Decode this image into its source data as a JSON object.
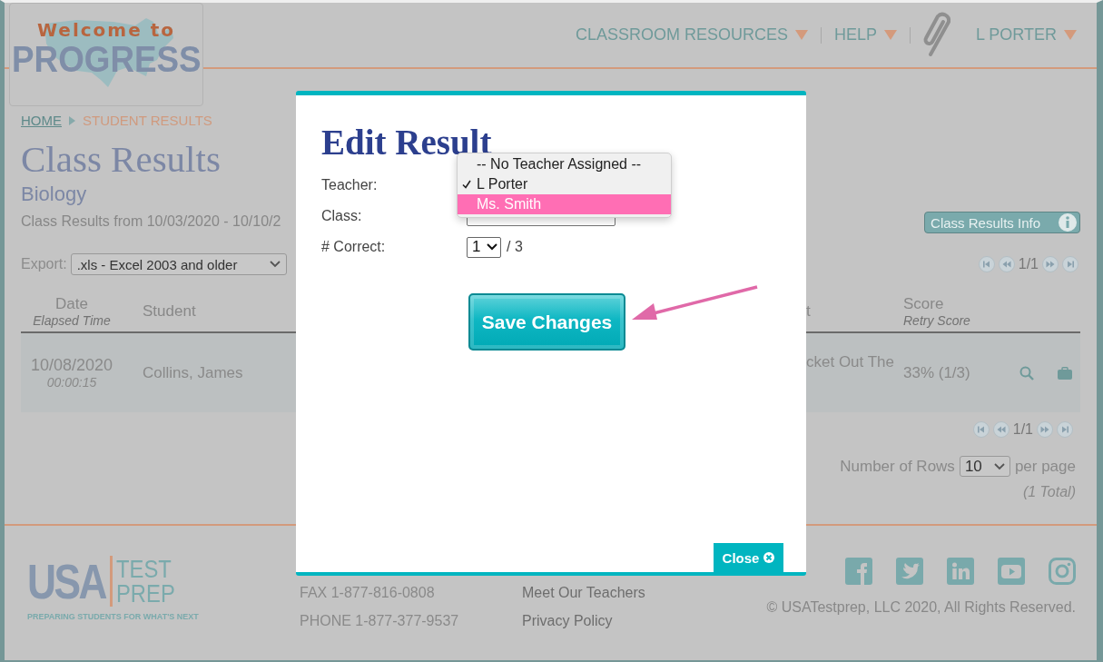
{
  "header": {
    "logo": {
      "line1": "Welcome to",
      "line2": "PROGRESS"
    },
    "nav": [
      {
        "label": "CLASSROOM RESOURCES",
        "kind": "menu"
      },
      {
        "label": "HELP",
        "kind": "menu"
      },
      {
        "label": "L PORTER",
        "kind": "user"
      }
    ]
  },
  "breadcrumb": [
    {
      "label": "HOME",
      "kind": "link"
    },
    {
      "label": "STUDENT RESULTS",
      "kind": "current"
    }
  ],
  "page_title": "Class Results",
  "subtitle": "Biology",
  "date_range": "Class Results from 10/03/2020 - 10/10/2",
  "info_button": "Class Results Info",
  "export": {
    "label": "Export:",
    "value": ".xls - Excel 2003 and older"
  },
  "pagination_top": "1/1",
  "pagination_bottom": "1/1",
  "table": {
    "columns": [
      {
        "title": "Date",
        "subtitle": "Elapsed Time"
      },
      {
        "title": "Student"
      },
      {
        "title": "t"
      },
      {
        "title": "Score",
        "subtitle": "Retry Score"
      }
    ],
    "rows": [
      {
        "date": "10/08/2020",
        "elapsed": "00:00:15",
        "student": "Collins, James",
        "column_3": "cket Out The",
        "score": "33% (1/3)"
      }
    ]
  },
  "rows_per_page": {
    "label": "Number of Rows",
    "value": "10",
    "suffix": "per page"
  },
  "total": "(1 Total)",
  "footer": {
    "logo": {
      "usa": "USA",
      "test": "TEST",
      "prep": "PREP",
      "tagline": "PREPARING STUDENTS FOR WHAT'S NEXT"
    },
    "contact": [
      "FAX 1-877-816-0808",
      "PHONE 1-877-377-9537"
    ],
    "links": [
      "Meet Our Teachers",
      "Privacy Policy"
    ],
    "copyright": "© USATestprep, LLC 2020, All Rights Reserved."
  },
  "modal": {
    "title": "Edit Result",
    "fields": [
      {
        "label": "Teacher:",
        "kind": "teacher"
      },
      {
        "label": "Class:",
        "kind": "class"
      },
      {
        "label": "# Correct:",
        "kind": "count",
        "value": "1",
        "suffix": "/ 3"
      }
    ],
    "dropdown": [
      {
        "label": "-- No Teacher Assigned --",
        "selected": false,
        "highlighted": false
      },
      {
        "label": "L Porter",
        "selected": true,
        "highlighted": false
      },
      {
        "label": "Ms. Smith",
        "selected": false,
        "highlighted": true
      }
    ],
    "save_button": "Save Changes",
    "close_button": "Close"
  }
}
